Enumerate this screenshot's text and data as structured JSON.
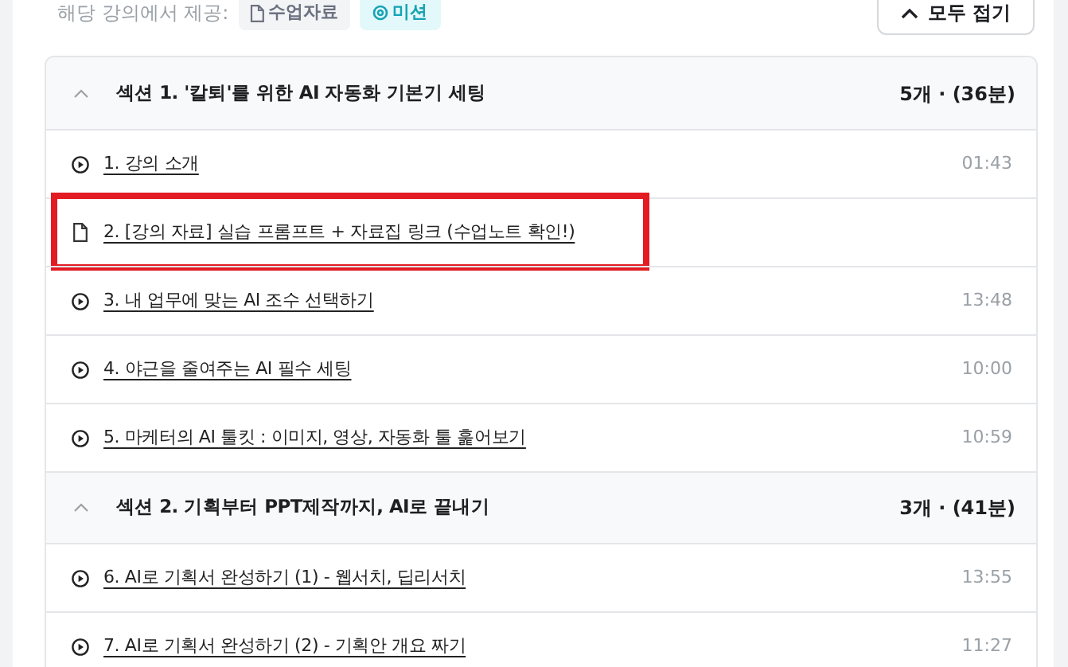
{
  "provided": {
    "label": "해당 강의에서 제공:",
    "badges": [
      {
        "kind": "material",
        "label": "수업자료"
      },
      {
        "kind": "mission",
        "label": "미션"
      }
    ]
  },
  "collapse_all_button": {
    "label": "모두 접기"
  },
  "sections": [
    {
      "title": "섹션 1. '칼퇴'를 위한 AI 자동화 기본기 세팅",
      "summary": "5개 · (36분)",
      "expanded": true,
      "lessons": [
        {
          "kind": "video",
          "title": "1. 강의 소개",
          "duration": "01:43",
          "highlighted": false
        },
        {
          "kind": "document",
          "title": "2. [강의 자료] 실습 프롬프트 + 자료집 링크 (수업노트 확인!)",
          "highlighted": true
        },
        {
          "kind": "video",
          "title": "3. 내 업무에 맞는 AI 조수 선택하기",
          "duration": "13:48",
          "highlighted": false
        },
        {
          "kind": "video",
          "title": "4. 야근을 줄여주는 AI 필수 세팅",
          "duration": "10:00",
          "highlighted": false
        },
        {
          "kind": "video",
          "title": "5. 마케터의 AI 툴킷 : 이미지, 영상, 자동화 툴 훑어보기",
          "duration": "10:59",
          "highlighted": false
        }
      ]
    },
    {
      "title": "섹션 2. 기획부터 PPT제작까지, AI로 끝내기",
      "summary": "3개 · (41분)",
      "expanded": true,
      "lessons": [
        {
          "kind": "video",
          "title": "6. AI로 기획서 완성하기 (1) - 웹서치, 딥리서치",
          "duration": "13:55",
          "highlighted": false
        },
        {
          "kind": "video",
          "title": "7. AI로 기획서 완성하기 (2) - 기획안 개요 짜기",
          "duration": "11:27",
          "highlighted": false
        }
      ]
    }
  ]
}
